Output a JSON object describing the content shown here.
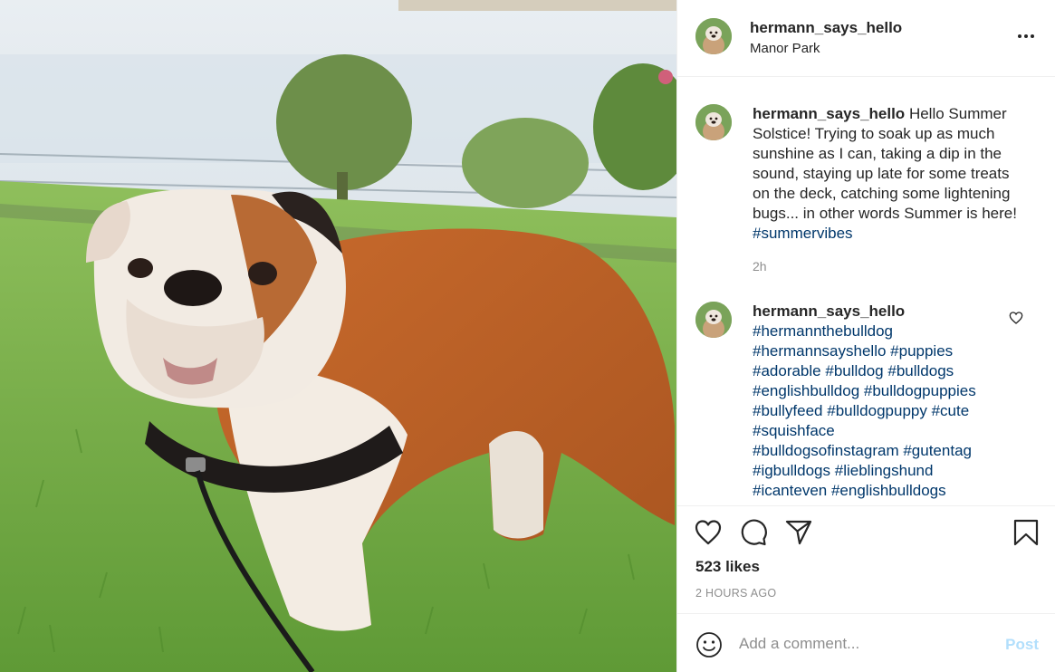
{
  "post": {
    "username": "hermann_says_hello",
    "location": "Manor Park",
    "caption": {
      "username": "hermann_says_hello",
      "text": "Hello Summer Solstice! Trying to soak up as much sunshine as I can, taking a dip in the sound, staying up late for some treats on the deck, catching some lightening bugs... in other words Summer is here!",
      "hashtag": "#summervibes",
      "time": "2h"
    },
    "comment": {
      "username": "hermann_says_hello",
      "hashtags": [
        "#hermannthebulldog",
        "#hermannsayshello",
        "#puppies",
        "#adorable",
        "#bulldog",
        "#bulldogs",
        "#englishbulldog",
        "#bulldogpuppies",
        "#bullyfeed",
        "#bulldogpuppy",
        "#cute",
        "#squishface",
        "#bulldogsofinstagram",
        "#gutentag",
        "#igbulldogs",
        "#lieblingshund",
        "#icanteven",
        "#englishbulldogs"
      ]
    },
    "likes": "523 likes",
    "timestamp": "2 HOURS AGO",
    "comment_box": {
      "placeholder": "Add a comment...",
      "post_label": "Post"
    },
    "icons": {
      "more": "more-options-icon",
      "like": "heart-icon",
      "comment": "comment-icon",
      "share": "share-icon",
      "save": "bookmark-icon",
      "emoji": "emoji-icon"
    },
    "colors": {
      "hashtag": "#00376b",
      "muted": "#8e8e8e",
      "post_button": "#b2dffc"
    }
  }
}
